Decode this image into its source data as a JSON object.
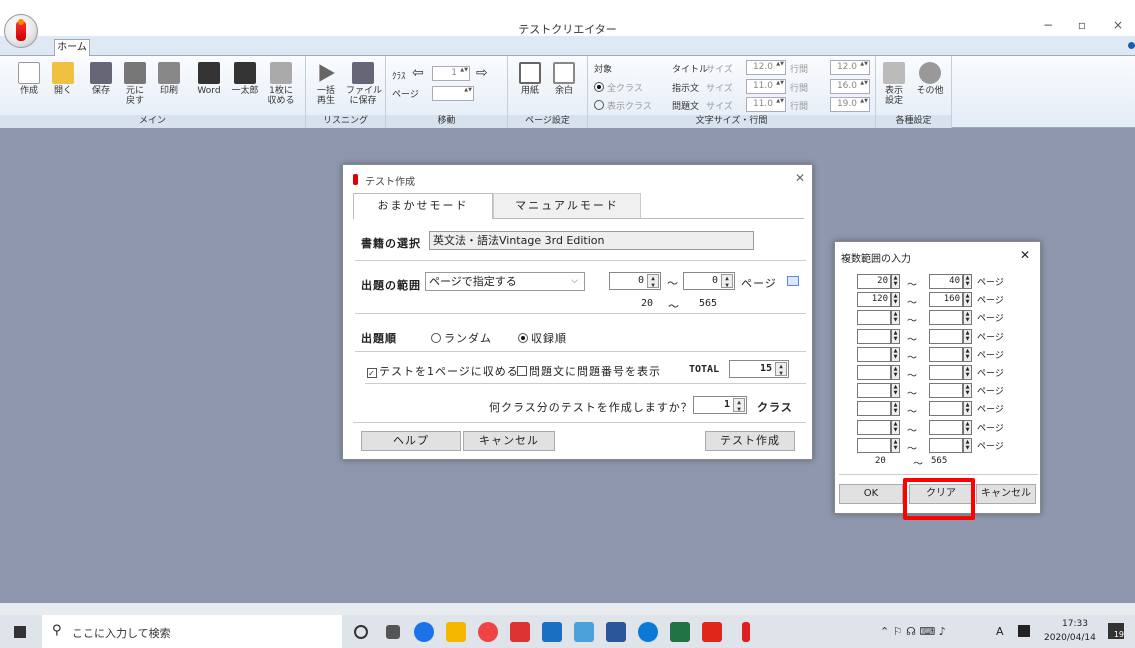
{
  "window": {
    "title": "テストクリエイター",
    "minimize": "−",
    "maximize": "▫",
    "close": "×"
  },
  "ribbon": {
    "tab": "ホーム",
    "buttons": {
      "create": "作成",
      "open": "開く",
      "save": "保存",
      "undo": "元に\n戻す",
      "print": "印刷",
      "word": "Word",
      "ichitaro": "一太郎",
      "fit1": "1枚に\n収める",
      "playall": "一括\n再生",
      "savefile": "ファイル\nに保存",
      "paper": "用紙",
      "margin": "余白",
      "display": "表示\n設定",
      "other": "その他"
    },
    "groups": {
      "main": "メイン",
      "listening": "リスニング",
      "move": "移動",
      "page": "ページ設定",
      "font": "文字サイズ・行間",
      "settings": "各種設定"
    },
    "move": {
      "class_label": "ｸﾗｽ",
      "class_value": "1",
      "page_label": "ページ"
    },
    "target": {
      "label": "対象",
      "all": "全クラス",
      "display": "表示クラス"
    },
    "font": {
      "title": "タイトル",
      "instruct": "指示文",
      "question": "問題文",
      "size": "サイズ",
      "line": "行間",
      "title_size": "12.0",
      "title_line": "12.0",
      "instruct_size": "11.0",
      "instruct_line": "16.0",
      "question_size": "11.0",
      "question_line": "19.0"
    }
  },
  "main_dialog": {
    "title": "テスト作成",
    "tab_auto": "おまかせモード",
    "tab_manual": "マニュアルモード",
    "book_label": "書籍の選択",
    "book_value": "英文法・語法Vintage 3rd Edition",
    "range_label": "出題の範囲",
    "range_select": "ページで指定する",
    "range_from": "0",
    "range_to": "0",
    "tilde": "～",
    "page_unit": "ページ",
    "range_min": "20",
    "range_max": "565",
    "order_label": "出題順",
    "order_random": "ランダム",
    "order_book": "収録順",
    "fit_check": "テストを1ページに収める",
    "number_check": "問題文に問題番号を表示",
    "total_label": "TOTAL",
    "total_value": "15",
    "class_question": "何クラス分のテストを作成しますか？",
    "class_value": "1",
    "class_unit": "クラス",
    "help": "ヘルプ",
    "cancel": "キャンセル",
    "create": "テスト作成"
  },
  "range_dialog": {
    "title": "複数範囲の入力",
    "rows": [
      {
        "from": "20",
        "to": "40"
      },
      {
        "from": "120",
        "to": "160"
      },
      {
        "from": "",
        "to": ""
      },
      {
        "from": "",
        "to": ""
      },
      {
        "from": "",
        "to": ""
      },
      {
        "from": "",
        "to": ""
      },
      {
        "from": "",
        "to": ""
      },
      {
        "from": "",
        "to": ""
      },
      {
        "from": "",
        "to": ""
      },
      {
        "from": "",
        "to": ""
      }
    ],
    "tilde": "～",
    "page_unit": "ページ",
    "min": "20",
    "max": "565",
    "ok": "OK",
    "clear": "クリア",
    "cancel": "キャンセル"
  },
  "taskbar": {
    "search_placeholder": "ここに入力して検索",
    "time": "17:33",
    "date": "2020/04/14",
    "ime": "A",
    "notif": "19"
  },
  "colors": {
    "workspace": "#8e97ad",
    "highlight": "#ff0000",
    "ribbon": "#e4ecf6"
  }
}
